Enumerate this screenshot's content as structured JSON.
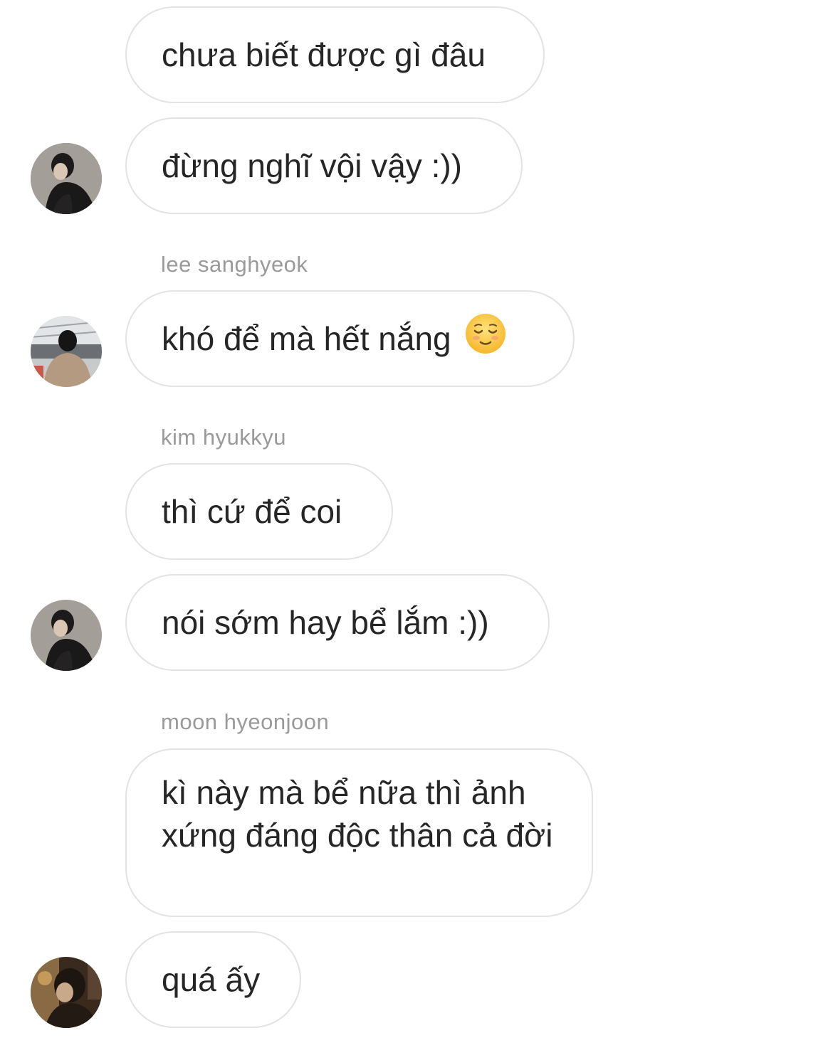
{
  "messages": [
    {
      "text": "chưa biết được gì đâu"
    },
    {
      "text": "đừng nghĩ vội vậy :))"
    },
    {
      "sender": "lee sanghyeok",
      "text": "khó để mà hết nắng",
      "emoji": "relieved-face"
    },
    {
      "sender": "kim hyukkyu",
      "text": "thì cứ để coi"
    },
    {
      "text": "nói sớm hay bể lắm :))"
    },
    {
      "sender": "moon hyeonjoon",
      "text": "kì này mà bể nữa thì ảnh xứng đáng độc thân cả đời"
    },
    {
      "text": "quá ấy"
    }
  ],
  "avatars": [
    {
      "icon": "avatar-dark-jacket-photo"
    },
    {
      "icon": "avatar-airport-photo"
    },
    {
      "icon": "avatar-dark-jacket-photo"
    },
    {
      "icon": "avatar-warm-toned-photo"
    }
  ],
  "colors": {
    "bubble_border": "#e3e3e3",
    "text": "#262626",
    "sender": "#9a9a9a",
    "background": "#ffffff"
  }
}
